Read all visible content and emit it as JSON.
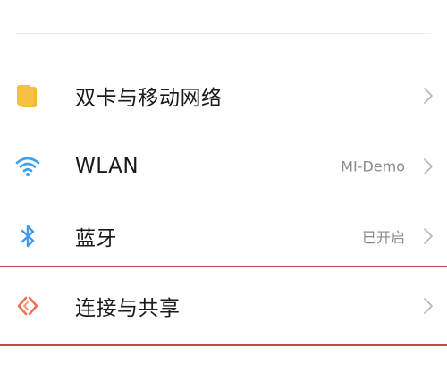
{
  "settings": {
    "items": [
      {
        "label": "双卡与移动网络",
        "value": "",
        "icon": "sim-card-icon"
      },
      {
        "label": "WLAN",
        "value": "MI-Demo",
        "icon": "wifi-icon"
      },
      {
        "label": "蓝牙",
        "value": "已开启",
        "icon": "bluetooth-icon"
      },
      {
        "label": "连接与共享",
        "value": "",
        "icon": "connection-sharing-icon"
      }
    ]
  },
  "colors": {
    "sim_icon": "#f6c143",
    "wifi_icon": "#3aa0ef",
    "bluetooth_icon": "#3f9be8",
    "connection_icon": "#ef7055",
    "highlight_border": "#c74747",
    "label_text": "#1a1a1a",
    "value_text": "#8a8a8a"
  }
}
